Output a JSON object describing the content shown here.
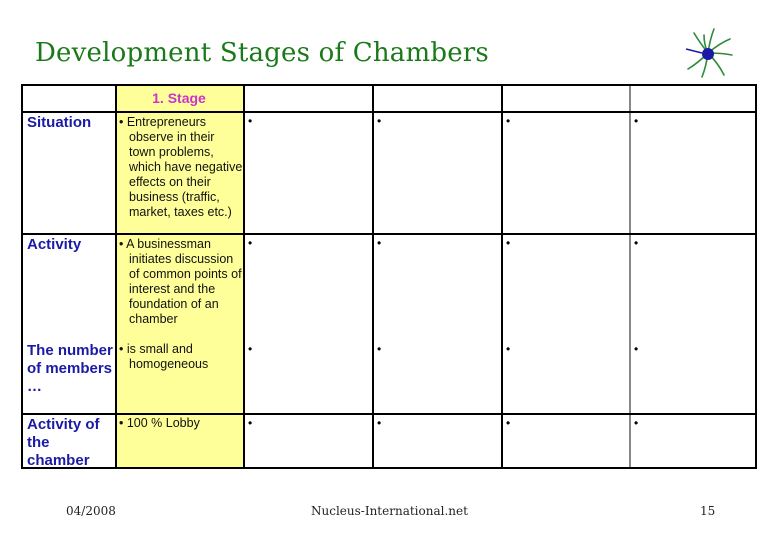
{
  "slide": {
    "title": "Development Stages of Chambers",
    "logo_icon": "sunburst-logo-icon"
  },
  "table": {
    "header": [
      "",
      "1. Stage",
      "",
      "",
      "",
      ""
    ],
    "rows": [
      {
        "label": "Situation",
        "stage1": "• Entrepreneurs observe in their town problems, which have negative effects on their business (traffic, market, taxes etc.)",
        "others": [
          "•",
          "•",
          "•",
          "•"
        ]
      },
      {
        "label": "Activity",
        "stage1": "• A businessman initiates discussion of common points of interest and the foundation of an chamber",
        "others": [
          "•",
          "•",
          "•",
          "•"
        ]
      },
      {
        "label": "The number of members …",
        "stage1": "• is small and homogeneous",
        "others": [
          "•",
          "•",
          "•",
          "•"
        ]
      },
      {
        "label": "Activity of the chamber",
        "stage1": "• 100 % Lobby",
        "others": [
          "•",
          "•",
          "•",
          "•"
        ]
      }
    ]
  },
  "footer": {
    "date": "04/2008",
    "site": "Nucleus-International.net",
    "page": "15"
  },
  "colors": {
    "title": "#1a7a1a",
    "row_label": "#1a1aa6",
    "stage_header": "#cc33cc",
    "stage_fill": "#ffff99"
  }
}
